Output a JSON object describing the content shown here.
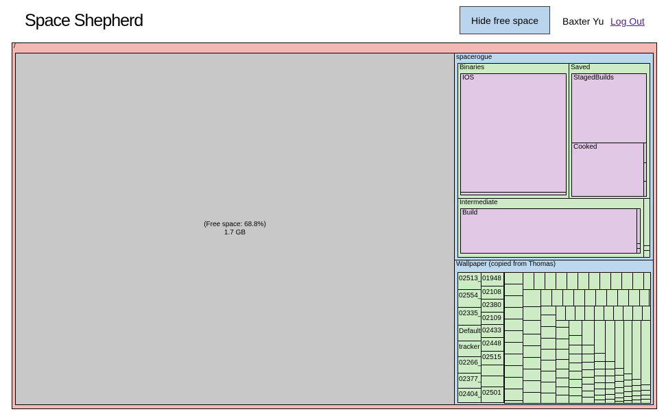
{
  "header": {
    "app_title": "Space Shepherd",
    "toggle_label": "Hide free space",
    "user_name": "Baxter Yu",
    "logout_label": "Log Out"
  },
  "colors": {
    "root": "#f4b8b4",
    "folder": "#bcd8ee",
    "subfolder": "#cdecc5",
    "leaf": "#e1c9e6",
    "free": "#c8c8c8",
    "button": "#b9d4ec"
  },
  "treemap": {
    "root_label": "/",
    "free_space": {
      "label": "(Free space: 68.8%)",
      "size": "1.7 GB",
      "percent": 68.8
    },
    "spacerogue": {
      "label": "spacerogue",
      "binaries": {
        "label": "Binaries",
        "ios": "IOS"
      },
      "saved": {
        "label": "Saved",
        "staged": "StagedBuilds",
        "cooked": "Cooked"
      },
      "intermediate": {
        "label": "Intermediate",
        "build": "Build"
      }
    },
    "wallpaper": {
      "label": "Wallpaper (copied from Thomas)",
      "col1": [
        "02513_",
        "02554_",
        "02335_",
        "Default",
        "tracker",
        "02266_",
        "02377_",
        "02404_"
      ],
      "col2": [
        "01948",
        "02108",
        "02380",
        "02109",
        "02433",
        "02448",
        "02515",
        "",
        "",
        "02501"
      ]
    }
  }
}
